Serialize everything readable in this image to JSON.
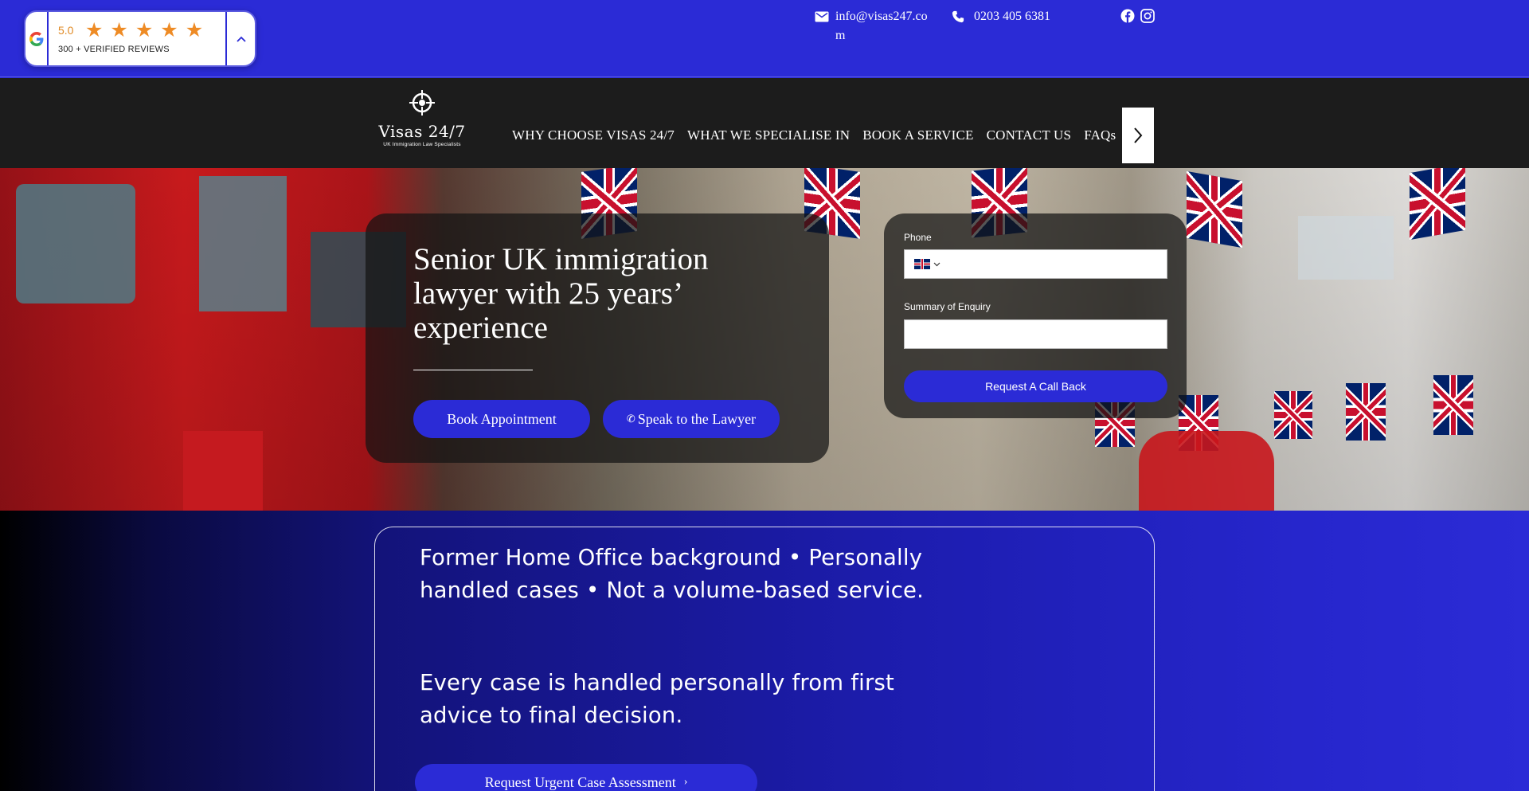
{
  "reviews": {
    "score": "5.0",
    "stars": [
      "★",
      "★",
      "★",
      "★",
      "★"
    ],
    "count_label": "300 + VERIFIED REVIEWS",
    "icon": "google-icon",
    "toggle_icon": "chevron-up-icon"
  },
  "contact": {
    "email": "info@visas247.com",
    "email_icon": "mail-icon",
    "phone": "0203 405 6381",
    "phone_icon": "phone-icon"
  },
  "social": [
    "facebook-icon",
    "instagram-icon"
  ],
  "logo": {
    "name": "Visas 24/7",
    "tagline": "UK Immigration Law Specialists",
    "icon": "crosshair-logo-icon"
  },
  "nav": {
    "items": [
      "WHY CHOOSE VISAS 24/7",
      "WHAT WE SPECIALISE IN",
      "BOOK A SERVICE",
      "CONTACT US",
      "FAQs"
    ],
    "next_icon": "chevron-right-icon"
  },
  "hero": {
    "headline": "Senior UK immigration lawyer with 25 years’ experience",
    "book_button": "Book Appointment",
    "speak_button": "Speak to the Lawyer",
    "speak_icon_glyph": "✆"
  },
  "callback_form": {
    "phone_label": "Phone",
    "phone_value": "",
    "country_icon": "uk-flag-icon",
    "summary_label": "Summary of Enquiry",
    "summary_value": "",
    "submit_label": "Request A Call Back"
  },
  "about": {
    "line1": "Former Home Office background • Personally handled cases • Not a volume-based service.",
    "line2": "Every case is handled personally from first advice to final decision.",
    "cta": "Request Urgent Case Assessment",
    "cta_icon_glyph": "›"
  },
  "colors": {
    "brand_blue": "#2b2bd6",
    "nav_dark": "#1c1c1c",
    "star_orange": "#ee8b25",
    "panel_overlay": "rgba(20,20,20,0.72)"
  }
}
